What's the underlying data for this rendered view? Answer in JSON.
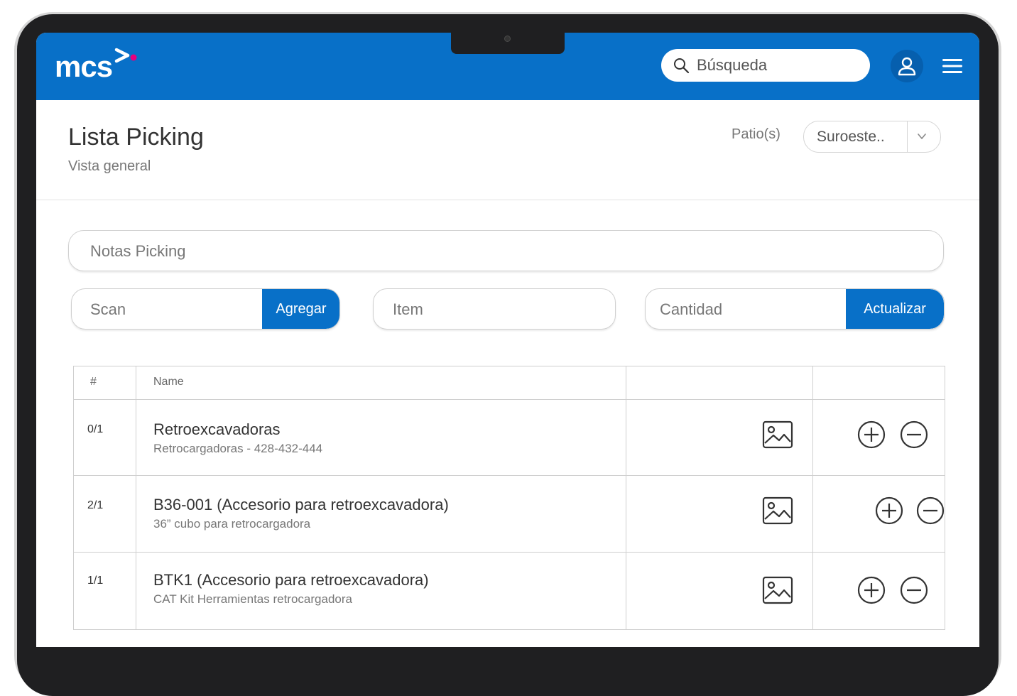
{
  "header": {
    "brand": "mcs",
    "search_placeholder": "Búsqueda"
  },
  "colors": {
    "primary": "#0870c8",
    "logo_accent": "#e6007e",
    "bezel": "#1f1f21"
  },
  "page": {
    "title": "Lista Picking",
    "subtitle": "Vista general",
    "patio_label": "Patio(s)",
    "patio_value": "Suroeste.."
  },
  "form": {
    "notes_placeholder": "Notas Picking",
    "scan_placeholder": "Scan",
    "add_button": "Agregar",
    "item_placeholder": "Item",
    "qty_placeholder": "Cantidad",
    "update_button": "Actualizar"
  },
  "table": {
    "columns": [
      "#",
      "Name",
      "",
      ""
    ],
    "rows": [
      {
        "count": "0/1",
        "name": "Retroexcavadoras",
        "sub": "Retrocargadoras - 428-432-444"
      },
      {
        "count": "2/1",
        "name": "B36-001 (Accesorio para retroexcavadora)",
        "sub": "36” cubo para retrocargadora"
      },
      {
        "count": "1/1",
        "name": "BTK1 (Accesorio para retroexcavadora)",
        "sub": "CAT Kit Herramientas retrocargadora"
      }
    ]
  },
  "icons": {
    "search": "search-icon",
    "user": "user-icon",
    "menu": "menu-icon",
    "dropdown": "chevron-down-icon",
    "image": "image-icon",
    "add": "plus-circle-icon",
    "remove": "minus-circle-icon"
  }
}
